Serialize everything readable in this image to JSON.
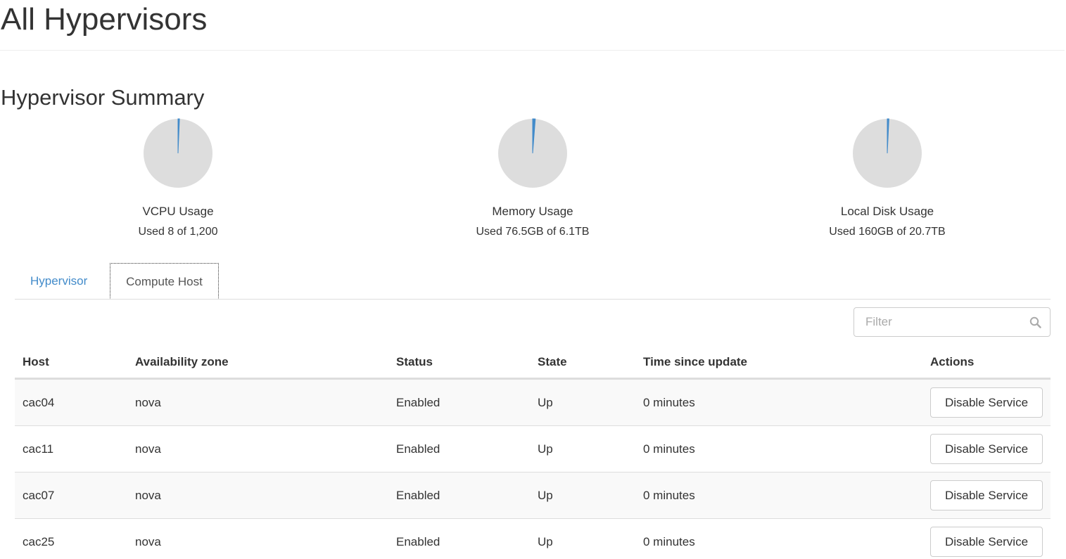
{
  "page": {
    "title": "All Hypervisors"
  },
  "summary": {
    "title": "Hypervisor Summary",
    "colors": {
      "used": "#428bca",
      "free": "#dddddd"
    },
    "charts": [
      {
        "label": "VCPU Usage",
        "text": "Used 8 of 1,200",
        "used": 8,
        "total": 1200
      },
      {
        "label": "Memory Usage",
        "text": "Used 76.5GB of 6.1TB",
        "used": 76.5,
        "total": 6246.4
      },
      {
        "label": "Local Disk Usage",
        "text": "Used 160GB of 20.7TB",
        "used": 160,
        "total": 21196.8
      }
    ]
  },
  "tabs": {
    "hypervisor": "Hypervisor",
    "compute_host": "Compute Host"
  },
  "filter": {
    "placeholder": "Filter"
  },
  "table": {
    "headers": {
      "host": "Host",
      "zone": "Availability zone",
      "status": "Status",
      "state": "State",
      "time": "Time since update",
      "actions": "Actions"
    },
    "rows": [
      {
        "host": "cac04",
        "zone": "nova",
        "status": "Enabled",
        "state": "Up",
        "time": "0 minutes",
        "action": "Disable Service"
      },
      {
        "host": "cac11",
        "zone": "nova",
        "status": "Enabled",
        "state": "Up",
        "time": "0 minutes",
        "action": "Disable Service"
      },
      {
        "host": "cac07",
        "zone": "nova",
        "status": "Enabled",
        "state": "Up",
        "time": "0 minutes",
        "action": "Disable Service"
      },
      {
        "host": "cac25",
        "zone": "nova",
        "status": "Enabled",
        "state": "Up",
        "time": "0 minutes",
        "action": "Disable Service"
      }
    ]
  }
}
